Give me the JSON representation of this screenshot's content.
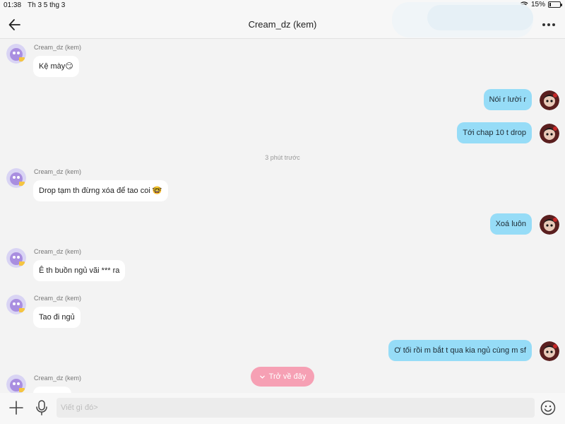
{
  "status_bar": {
    "time": "01:38",
    "date": "Th 3 5 thg 3",
    "battery": "15%",
    "battery_level": 0.15
  },
  "header": {
    "title": "Cream_dz (kem)"
  },
  "messages": [
    {
      "side": "in",
      "sender": "Cream_dz (kem)",
      "text": "Kệ mày😏"
    },
    {
      "side": "out",
      "text": "Nói r lười r"
    },
    {
      "side": "out",
      "text": "Tới chap 10 t drop"
    },
    {
      "timestamp": "3 phút trước"
    },
    {
      "side": "in",
      "sender": "Cream_dz (kem)",
      "text": "Drop tạm th đừng xóa để tao coi 🤓"
    },
    {
      "side": "out",
      "text": "Xoá luôn"
    },
    {
      "side": "in",
      "sender": "Cream_dz (kem)",
      "text": "Ê th buồn ngủ vãi *** ra"
    },
    {
      "side": "in",
      "sender": "Cream_dz (kem)",
      "text": "Tao đi ngủ"
    },
    {
      "side": "out",
      "text": "Ơ tối rồi m bắt t qua kia ngủ cùng m sf"
    },
    {
      "side": "in",
      "sender": "Cream_dz (kem)",
      "text": ""
    }
  ],
  "jump_button": {
    "label": "Trở về đây"
  },
  "composer": {
    "placeholder": "Viết gì đó>",
    "value": ""
  },
  "colors": {
    "outgoing_bubble": "#96dcf7",
    "incoming_bubble": "#ffffff",
    "jump_button": "#f6a0b4"
  }
}
